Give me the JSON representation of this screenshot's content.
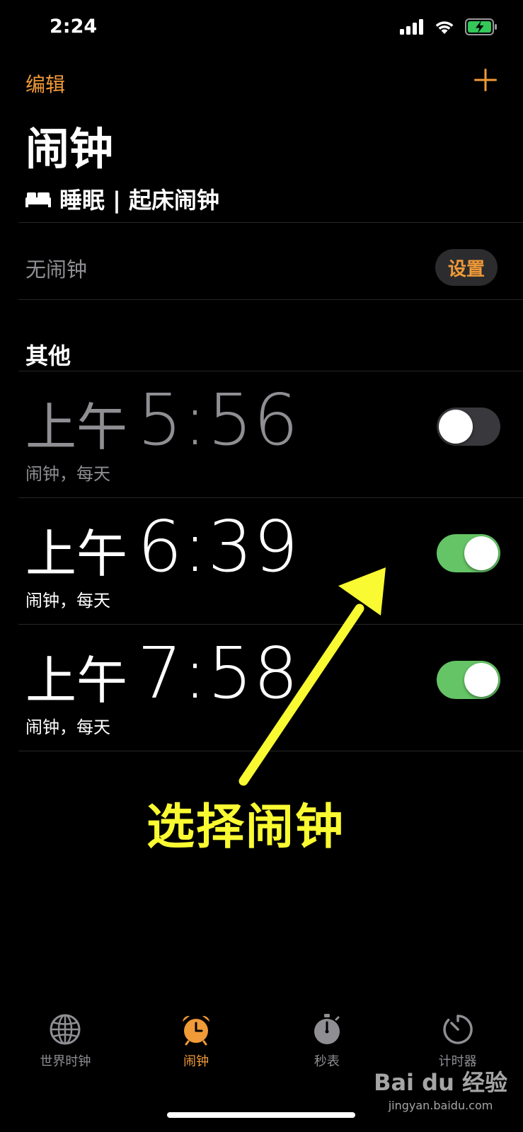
{
  "status": {
    "time": "2:24"
  },
  "nav": {
    "edit_label": "编辑",
    "add_icon": "plus-icon"
  },
  "page": {
    "title": "闹钟"
  },
  "sleep": {
    "label": "睡眠 | 起床闹钟",
    "no_alarm": "无闹钟",
    "setup_label": "设置"
  },
  "other": {
    "section_label": "其他"
  },
  "alarms": [
    {
      "ampm": "上午",
      "time": "5:56",
      "subtitle": "闹钟，每天",
      "enabled": false
    },
    {
      "ampm": "上午",
      "time": "6:39",
      "subtitle": "闹钟，每天",
      "enabled": true
    },
    {
      "ampm": "上午",
      "time": "7:58",
      "subtitle": "闹钟，每天",
      "enabled": true
    }
  ],
  "annotation": {
    "text": "选择闹钟"
  },
  "tabs": [
    {
      "label": "世界时钟",
      "icon": "globe-icon",
      "active": false
    },
    {
      "label": "闹钟",
      "icon": "alarm-clock-icon",
      "active": true
    },
    {
      "label": "秒表",
      "icon": "stopwatch-icon",
      "active": false
    },
    {
      "label": "计时器",
      "icon": "timer-icon",
      "active": false
    }
  ],
  "watermark": {
    "main": "Bai du 经验",
    "sub": "jingyan.baidu.com"
  },
  "colors": {
    "accent": "#f19a38",
    "toggle_on": "#65c466",
    "toggle_off": "#39393d",
    "annotation": "#f9fa31"
  }
}
